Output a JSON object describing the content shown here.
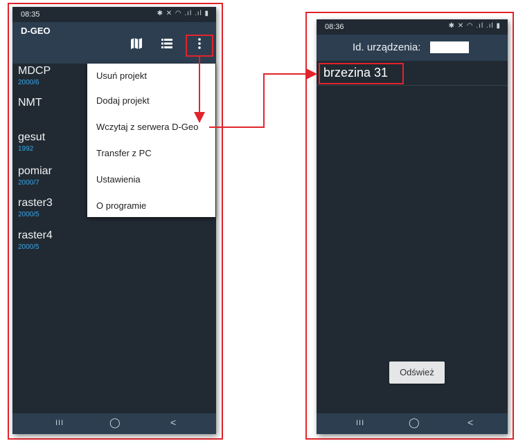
{
  "left_screen": {
    "status_time": "08:35",
    "status_icons": "✱ ✕ ◠ .ıl .ıl ▮",
    "app_title": "D-GEO",
    "toolbar_icons": [
      "map-icon",
      "list-icon",
      "more-vert-icon"
    ],
    "projects": [
      {
        "name": "MDCP",
        "date": "2000/6"
      },
      {
        "name": "NMT",
        "date": ""
      },
      {
        "name": "gesut",
        "date": "1992"
      },
      {
        "name": "pomiar",
        "date": "2000/7"
      },
      {
        "name": "raster3",
        "date": "2000/5"
      },
      {
        "name": "raster4",
        "date": "2000/5"
      }
    ],
    "menu": [
      "Usuń projekt",
      "Dodaj projekt",
      "Wczytaj z serwera D-Geo",
      "Transfer z PC",
      "Ustawienia",
      "O programie"
    ],
    "nav": {
      "recent": "III",
      "home": "◯",
      "back": "<"
    }
  },
  "right_screen": {
    "status_time": "08:36",
    "status_icons": "✱ ✕ ◠ .ıl .ıl ▮",
    "device_id_label": "Id. urządzenia:",
    "device_projects": [
      "brzezina 31"
    ],
    "refresh_button": "Odśwież",
    "nav": {
      "recent": "III",
      "home": "◯",
      "back": "<"
    }
  },
  "colors": {
    "annotation": "#e3232b",
    "app_bg": "#212a32",
    "app_bar": "#2c3e50",
    "date_text": "#3aa6e8"
  }
}
